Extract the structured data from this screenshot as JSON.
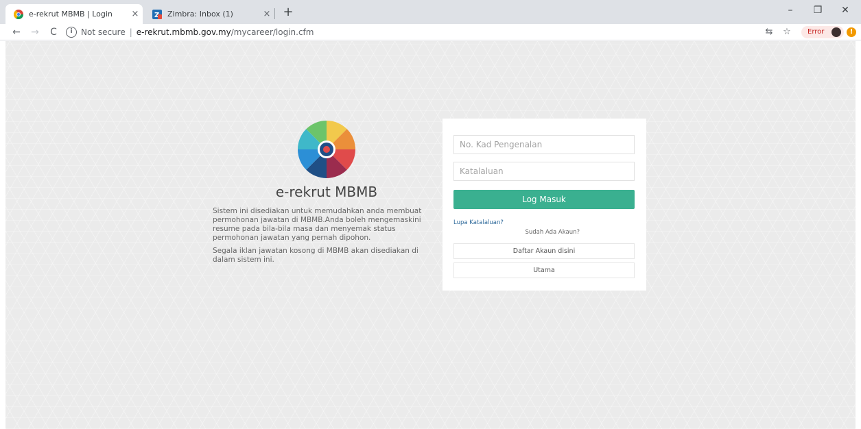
{
  "browser": {
    "tabs": [
      {
        "title": "e-rekrut MBMB | Login",
        "close": "×"
      },
      {
        "title": "Zimbra: Inbox (1)",
        "close": "×"
      }
    ],
    "new_tab": "+",
    "window_controls": {
      "minimize": "–",
      "maximize": "❐",
      "close": "✕"
    },
    "nav": {
      "back": "←",
      "forward": "→",
      "reload": "C"
    },
    "address": {
      "security_label": "Not secure",
      "separator": "|",
      "host": "e-rekrut.mbmb.gov.my",
      "path": "/mycareer/login.cfm"
    },
    "translate_icon": "⇆",
    "bookmark_icon": "☆",
    "profile_status": "Error",
    "warning_glyph": "!"
  },
  "page": {
    "brand_title": "e-rekrut MBMB",
    "description": [
      "Sistem ini disediakan untuk memudahkan anda membuat permohonan jawatan di MBMB.Anda boleh mengemaskini resume pada bila-bila masa dan menyemak status permohonan jawatan yang pernah dipohon.",
      "Segala iklan jawatan kosong di MBMB akan disediakan di dalam sistem ini."
    ],
    "login": {
      "ic_placeholder": "No. Kad Pengenalan",
      "password_placeholder": "Katalaluan",
      "submit_label": "Log Masuk",
      "forgot_link": "Lupa Katalaluan?",
      "has_account": "Sudah Ada Akaun?",
      "register_label": "Daftar Akaun disini",
      "home_label": "Utama"
    }
  },
  "colors": {
    "primary_button": "#3ab090",
    "link": "#2f6a9b",
    "background": "#ebebeb"
  }
}
